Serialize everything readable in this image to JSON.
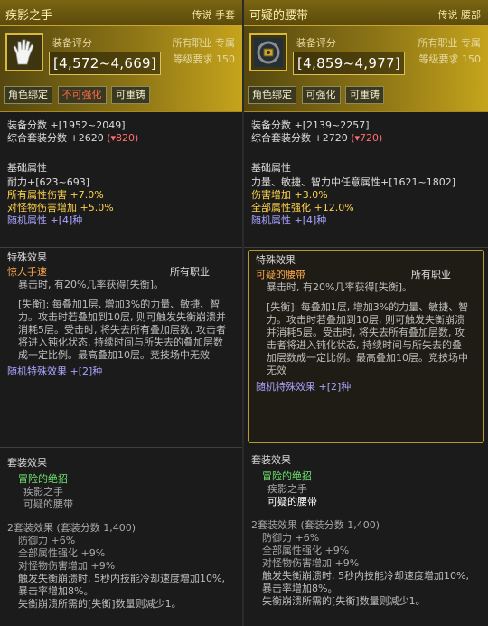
{
  "left": {
    "title": "疾影之手",
    "type": "传说 手套",
    "icon": "glove-icon",
    "score_label": "装备评分",
    "score": "[4,572~4,669]",
    "job": "所有职业 专属",
    "level": "等级要求 150",
    "tags": [
      "角色绑定",
      "不可强化",
      "可重铸"
    ],
    "equip_score": "装备分数 +[1952~2049]",
    "set_score": "综合套装分数 +2620",
    "set_score_delta": "(▾820)",
    "base_title": "基础属性",
    "base_lines": [
      {
        "text": "耐力+[623~693]",
        "color": "white"
      },
      {
        "text": "所有属性伤害 +7.0%",
        "color": "yellow"
      },
      {
        "text": "对怪物伤害增加 +5.0%",
        "color": "yellow"
      },
      {
        "text": "随机属性 +[4]种",
        "color": "purple"
      }
    ],
    "special_title": "特殊效果",
    "special_name": "惊人手速",
    "special_job": "所有职业",
    "special_desc": "暴击时, 有20%几率获得[失衡]。",
    "special_detail": "[失衡]: 每叠加1层, 增加3%的力量、敏捷、智力。攻击时若叠加到10层, 则可触发失衡崩溃并消耗5层。受击时, 将失去所有叠加层数, 攻击者将进入钝化状态, 持续时间与所失去的叠加层数成一定比例。最高叠加10层。竞技场中无效",
    "special_random": "随机特殊效果 +[2]种",
    "set_title": "套装效果",
    "set_name": "冒险的绝招",
    "set_items": [
      "疾影之手",
      "可疑的腰带"
    ],
    "set_bonus_title": "2套装效果 (套装分数 1,400)",
    "set_bonus_lines": [
      "防御力 +6%",
      "全部属性强化 +9%",
      "对怪物伤害增加 +9%",
      "触发失衡崩溃时, 5秒内技能冷却速度增加10%, 暴击率增加8%。",
      "失衡崩溃所需的[失衡]数量则减少1。"
    ]
  },
  "right": {
    "title": "可疑的腰带",
    "type": "传说 腰部",
    "icon": "belt-icon",
    "score_label": "装备评分",
    "score": "[4,859~4,977]",
    "job": "所有职业 专属",
    "level": "等级要求 150",
    "tags": [
      "角色绑定",
      "可强化",
      "可重铸"
    ],
    "equip_score": "装备分数 +[2139~2257]",
    "set_score": "综合套装分数 +2720",
    "set_score_delta": "(▾720)",
    "base_title": "基础属性",
    "base_lines": [
      {
        "text": "力量、敏捷、智力中任意属性+[1621~1802]",
        "color": "white"
      },
      {
        "text": "伤害增加 +3.0%",
        "color": "yellow"
      },
      {
        "text": "全部属性强化 +12.0%",
        "color": "yellow"
      },
      {
        "text": "随机属性 +[4]种",
        "color": "purple"
      }
    ],
    "special_title": "特殊效果",
    "special_name": "可疑的腰带",
    "special_job": "所有职业",
    "special_desc": "暴击时, 有20%几率获得[失衡]。",
    "special_detail": "[失衡]: 每叠加1层, 增加3%的力量、敏捷、智力。攻击时若叠加到10层, 则可触发失衡崩溃并消耗5层。受击时, 将失去所有叠加层数, 攻击者将进入钝化状态, 持续时间与所失去的叠加层数成一定比例。最高叠加10层。竞技场中无效",
    "special_random": "随机特殊效果 +[2]种",
    "set_title": "套装效果",
    "set_name": "冒险的绝招",
    "set_items": [
      "疾影之手",
      "可疑的腰带"
    ],
    "set_bonus_title": "2套装效果 (套装分数 1,400)",
    "set_bonus_lines": [
      "防御力 +6%",
      "全部属性强化 +9%",
      "对怪物伤害增加 +9%",
      "触发失衡崩溃时, 5秒内技能冷却速度增加10%, 暴击率增加8%。",
      "失衡崩溃所需的[失衡]数量则减少1。"
    ]
  },
  "colors": {
    "header": "#6b5810",
    "accent": "#d9b93a",
    "yellow": "#ffd24a",
    "purple": "#a9a4ff",
    "green": "#6de06d",
    "negative": "#ff6e6e"
  }
}
